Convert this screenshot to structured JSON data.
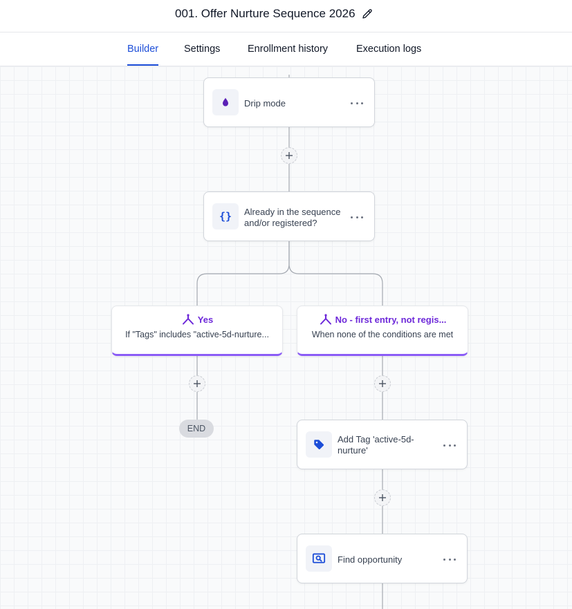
{
  "header": {
    "title": "001. Offer Nurture Sequence 2026"
  },
  "tabs": [
    {
      "label": "Builder",
      "active": true
    },
    {
      "label": "Settings",
      "active": false
    },
    {
      "label": "Enrollment history",
      "active": false
    },
    {
      "label": "Execution logs",
      "active": false
    }
  ],
  "nodes": {
    "drip": {
      "label": "Drip mode",
      "icon": "droplet-icon"
    },
    "condition": {
      "label_line1": "Already in the sequence",
      "label_line2": "and/or registered?",
      "icon": "curly-braces-icon"
    },
    "add_tag": {
      "label_line1": "Add Tag 'active-5d-",
      "label_line2": "nurture'",
      "icon": "tag-icon"
    },
    "find_opportunity": {
      "label": "Find opportunity",
      "icon": "search-box-icon"
    }
  },
  "branches": {
    "yes": {
      "name": "Yes",
      "description": "If \"Tags\" includes \"active-5d-nurture..."
    },
    "no": {
      "name": "No - first entry, not regis...",
      "description": "When none of the conditions are met"
    }
  },
  "end_label": "END",
  "colors": {
    "accent": "#1d4ed8",
    "branch": "#6d28d9",
    "icon_purple": "#5b21b6",
    "icon_blue": "#1d4ed8"
  }
}
